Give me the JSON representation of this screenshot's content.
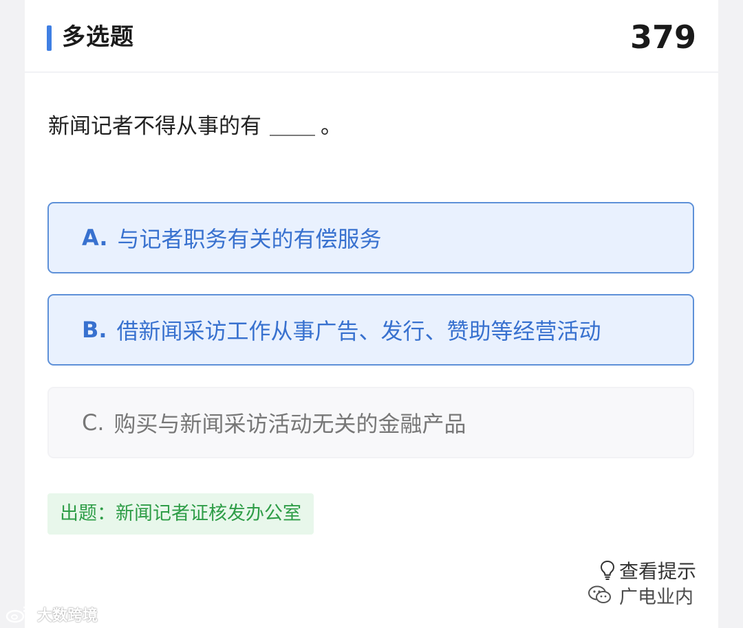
{
  "header": {
    "title": "多选题",
    "count": "379"
  },
  "question": {
    "text": "新闻记者不得从事的有",
    "suffix": "。"
  },
  "options": [
    {
      "letter": "A.",
      "text": "与记者职务有关的有偿服务",
      "selected": true
    },
    {
      "letter": "B.",
      "text": "借新闻采访工作从事广告、发行、赞助等经营活动",
      "selected": true
    },
    {
      "letter": "C.",
      "text": "购买与新闻采访活动无关的金融产品",
      "selected": false
    }
  ],
  "source": {
    "text": "出题：新闻记者证核发办公室"
  },
  "hint": {
    "label": "查看提示",
    "icon": "lightbulb-icon"
  },
  "watermarks": {
    "right": "广电业内",
    "right_icon": "wechat-icon",
    "left": "大数跨境",
    "left_icon": "weibo-icon"
  },
  "colors": {
    "accent": "#3f7fe3",
    "selected_bg": "#e9f1fe",
    "selected_border": "#5d90d8",
    "source_bg": "#e8f7eb",
    "source_text": "#2e9d47"
  }
}
